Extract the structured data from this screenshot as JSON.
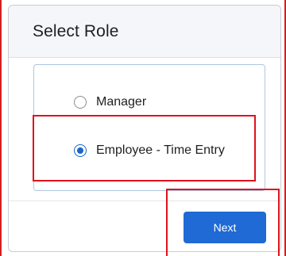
{
  "dialog": {
    "title": "Select Role",
    "options": [
      {
        "label": "Manager",
        "selected": false
      },
      {
        "label": "Employee - Time Entry",
        "selected": true
      }
    ],
    "next_label": "Next"
  },
  "colors": {
    "accent": "#1f6ad4",
    "highlight": "#e0121c",
    "header_bg": "#f4f6f9"
  }
}
